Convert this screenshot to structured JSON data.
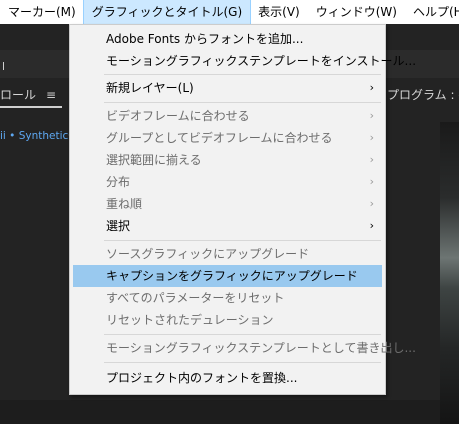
{
  "menubar": {
    "items": [
      {
        "label": "マーカー(M)"
      },
      {
        "label": "グラフィックとタイトル(G)",
        "active": true
      },
      {
        "label": "表示(V)"
      },
      {
        "label": "ウィンドウ(W)"
      },
      {
        "label": "ヘルプ(H)"
      }
    ]
  },
  "background": {
    "left_panel_title": "ロール",
    "left_panel_menu_icon": "hamburger-icon",
    "left_panel_entry": "ii • SyntheticCa",
    "right_panel_title": "プログラム : dou"
  },
  "dropdown": {
    "items": [
      {
        "label": "Adobe Fonts からフォントを追加...",
        "enabled": true
      },
      {
        "label": "モーショングラフィックステンプレートをインストール...",
        "enabled": true
      },
      {
        "label": "新規レイヤー(L)",
        "enabled": true,
        "submenu": true
      },
      {
        "label": "ビデオフレームに合わせる",
        "enabled": false,
        "submenu": true
      },
      {
        "label": "グループとしてビデオフレームに合わせる",
        "enabled": false,
        "submenu": true
      },
      {
        "label": "選択範囲に揃える",
        "enabled": false,
        "submenu": true
      },
      {
        "label": "分布",
        "enabled": false,
        "submenu": true
      },
      {
        "label": "重ね順",
        "enabled": false,
        "submenu": true
      },
      {
        "label": "選択",
        "enabled": true,
        "submenu": true
      },
      {
        "label": "ソースグラフィックにアップグレード",
        "enabled": false
      },
      {
        "label": "キャプションをグラフィックにアップグレード",
        "enabled": true,
        "highlighted": true
      },
      {
        "label": "すべてのパラメーターをリセット",
        "enabled": false
      },
      {
        "label": "リセットされたデュレーション",
        "enabled": false
      },
      {
        "label": "モーショングラフィックステンプレートとして書き出し...",
        "enabled": false
      },
      {
        "label": "プロジェクト内のフォントを置換...",
        "enabled": true
      }
    ],
    "submenu_glyph": "›"
  },
  "colors": {
    "highlight": "#99c9ef",
    "menubar_active": "#cce8ff",
    "disabled_text": "#6d6d6d",
    "link_blue": "#5ea8f2"
  }
}
